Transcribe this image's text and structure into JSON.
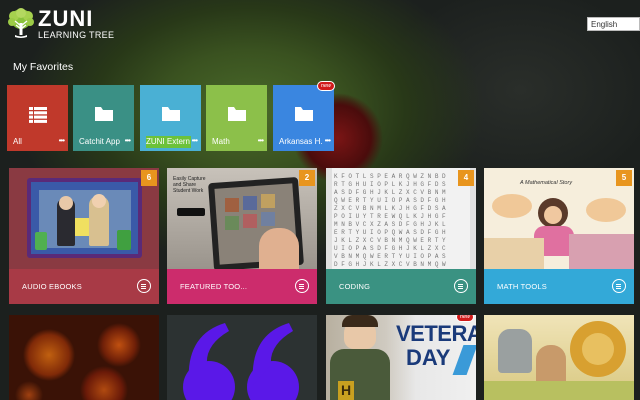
{
  "app": {
    "logo_name": "ZUNI",
    "logo_sub": "LEARNING TREE",
    "language": "English"
  },
  "favorites": {
    "title": "My Favorites",
    "new_badge": "new",
    "more": "•••",
    "items": [
      {
        "label": "All",
        "color": "#c0392b",
        "icon": "list-icon"
      },
      {
        "label": "Catchit App",
        "color": "#3a9085",
        "icon": "folder-icon"
      },
      {
        "label": "ZUNI Extern...",
        "color": "#4ab0d4",
        "icon": "folder-icon"
      },
      {
        "label": "Math",
        "color": "#8cc04a",
        "icon": "folder-icon"
      },
      {
        "label": "Arkansas H...",
        "color": "#3a86e0",
        "icon": "folder-icon"
      }
    ]
  },
  "cards": [
    {
      "label": "AUDIO EBOOKS",
      "count": "6",
      "color": "#a83a46"
    },
    {
      "label": "FEATURED TOO...",
      "count": "2",
      "color": "#cc2c6c"
    },
    {
      "label": "CODING",
      "count": "4",
      "color": "#3a9282"
    },
    {
      "label": "MATH TOOLS",
      "count": "5",
      "color": "#33a9d8"
    }
  ],
  "thumb_text": {
    "featured_line1": "Easily Capture",
    "featured_line2": "and Share",
    "featured_line3": "Student Work",
    "math_line1": "A Mathematical Story",
    "veterans_line1": "VETERA",
    "veterans_line2": "DAY"
  },
  "second_row_new_badge": "new"
}
